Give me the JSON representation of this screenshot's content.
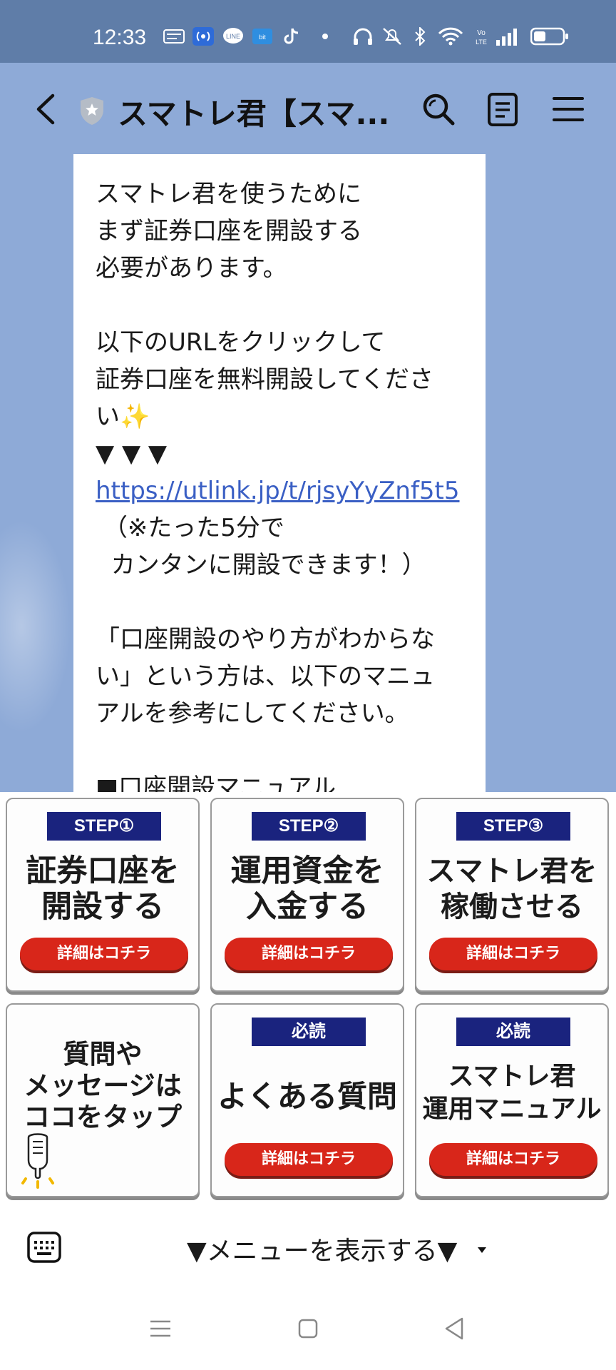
{
  "status_bar": {
    "time": "12:33",
    "icons": [
      "notification-icon",
      "radio-icon",
      "line-icon",
      "app-icon",
      "tiktok-icon",
      "dot-icon",
      "headphones-icon",
      "mute-icon",
      "bluetooth-icon",
      "wifi-icon",
      "volte-icon",
      "signal-icon",
      "battery-icon"
    ],
    "volte_label": "Vo LTE"
  },
  "header": {
    "title": "スマトレ君【スマ...",
    "icons": [
      "back-icon",
      "shield-icon",
      "search-icon",
      "notes-icon",
      "menu-icon"
    ]
  },
  "message": {
    "line1": "スマトレ君を使うために\nまず証券口座を開設する\n必要があります。\n\n以下のURLをクリックして\n証券口座を無料開設してくださ\nい✨\n▼ ▼ ▼",
    "link": "https://utlink.jp/t/rjsyYyZnf5t5",
    "line2": "\n （※たった5分で\n  カンタンに開設できます！）\n\n「口座開設のやり方がわからな\nい」という方は、以下のマニュ\nアルを参考にしてください。\n\n■口座開設マニュアル"
  },
  "rich_menu": {
    "tiles": [
      {
        "badge": "STEP①",
        "title": "証券口座を\n開設する",
        "button": "詳細はコチラ"
      },
      {
        "badge": "STEP②",
        "title": "運用資金を\n入金する",
        "button": "詳細はコチラ"
      },
      {
        "badge": "STEP③",
        "title": "スマトレ君を\n稼働させる",
        "button": "詳細はコチラ"
      },
      {
        "badge": "",
        "title": "質問や\nメッセージは\nココをタップ",
        "button": ""
      },
      {
        "badge": "必読",
        "title": "よくある質問",
        "button": "詳細はコチラ"
      },
      {
        "badge": "必読",
        "title": "スマトレ君\n運用マニュアル",
        "button": "詳細はコチラ"
      }
    ]
  },
  "bottom_bar": {
    "menu_toggle_label": "▼メニューを表示する▼"
  },
  "colors": {
    "chat_background": "#8eaad7",
    "status_bar": "#5f7da8",
    "badge": "#1a237e",
    "button_red": "#d8261a",
    "link": "#3a5fc4"
  }
}
